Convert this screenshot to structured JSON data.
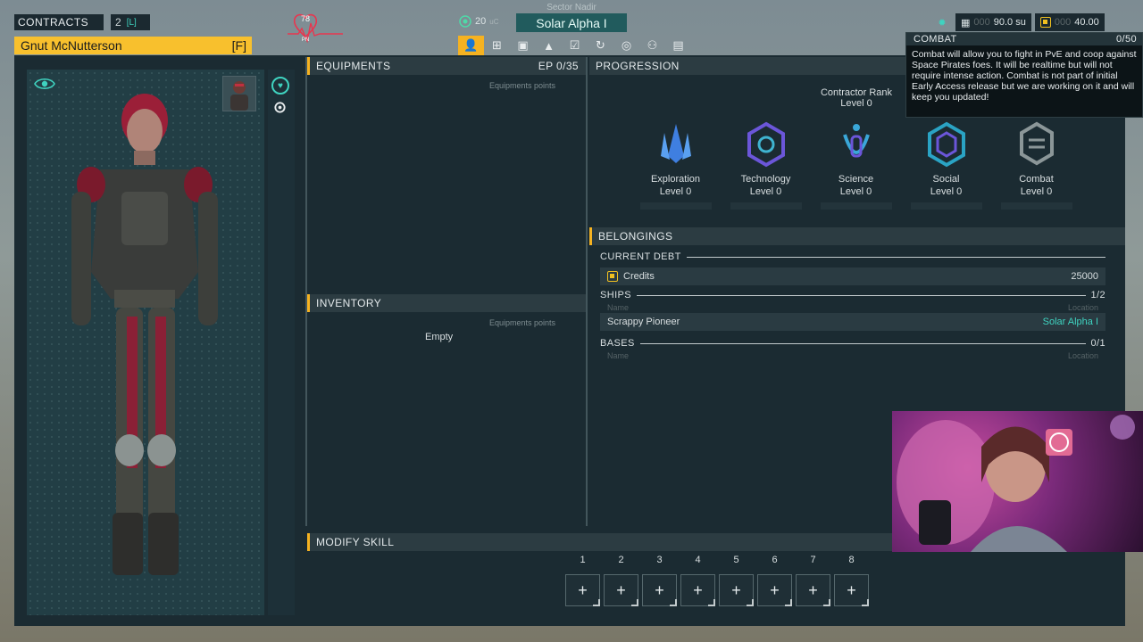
{
  "topbar": {
    "contracts_label": "CONTRACTS",
    "contracts_count": "2",
    "contracts_key": "[L]",
    "health_value": "78",
    "health_sub": "PN",
    "sector_label": "Sector Nadir",
    "credits_value": "20",
    "credits_unit": "uC",
    "ship_location": "Solar Alpha I",
    "storage_value": "90.0 su",
    "storage_dim": "000",
    "fuel_value": "40.00",
    "fuel_dim": "000"
  },
  "character": {
    "name": "Gnut McNutterson",
    "key": "[F]"
  },
  "tabs": [
    {
      "icon": "character-icon",
      "active": true
    },
    {
      "icon": "skill-tree-icon",
      "active": false
    },
    {
      "icon": "inventory-box-icon",
      "active": false
    },
    {
      "icon": "ship-icon",
      "active": false
    },
    {
      "icon": "checklist-icon",
      "active": false
    },
    {
      "icon": "history-icon",
      "active": false
    },
    {
      "icon": "globe-icon",
      "active": false
    },
    {
      "icon": "group-icon",
      "active": false
    },
    {
      "icon": "log-icon",
      "active": false
    }
  ],
  "equipments": {
    "title": "EQUIPMENTS",
    "ep": "EP 0/35",
    "points_label": "Equipments points"
  },
  "inventory": {
    "title": "INVENTORY",
    "points_label": "Equipments points",
    "empty_label": "Empty"
  },
  "progression": {
    "title": "PROGRESSION",
    "rank_label": "Contractor Rank",
    "rank_level": "Level 0",
    "skills": [
      {
        "name": "Exploration",
        "level": "Level 0",
        "color": "#3f7fe0"
      },
      {
        "name": "Technology",
        "level": "Level 0",
        "color": "#6b56d9"
      },
      {
        "name": "Science",
        "level": "Level 0",
        "color": "#3aa7d8"
      },
      {
        "name": "Social",
        "level": "Level 0",
        "color": "#2aa3c4"
      },
      {
        "name": "Combat",
        "level": "Level 0",
        "color": "#8b9698"
      }
    ]
  },
  "belongings": {
    "title": "BELONGINGS",
    "debt_label": "CURRENT DEBT",
    "credits_label": "Credits",
    "credits_value": "25000",
    "ships_label": "SHIPS",
    "ships_count": "1/2",
    "col_name": "Name",
    "col_location": "Location",
    "ship_name": "Scrappy Pioneer",
    "ship_location": "Solar Alpha I",
    "bases_label": "BASES",
    "bases_count": "0/1"
  },
  "modify_skill": {
    "title": "MODIFY SKILL",
    "slots": [
      "1",
      "2",
      "3",
      "4",
      "5",
      "6",
      "7",
      "8"
    ],
    "slot_symbol": "+"
  },
  "tooltip": {
    "title": "COMBAT",
    "count": "0/50",
    "body": "Combat will allow you to fight in PvE and coop against Space Pirates foes. It will be realtime but will not require intense action. Combat is not part of initial Early Access release but we are working on it and will keep you updated!"
  },
  "colors": {
    "accent": "#f5b221",
    "teal": "#3fd3c0",
    "panel": "#1b2b32"
  }
}
